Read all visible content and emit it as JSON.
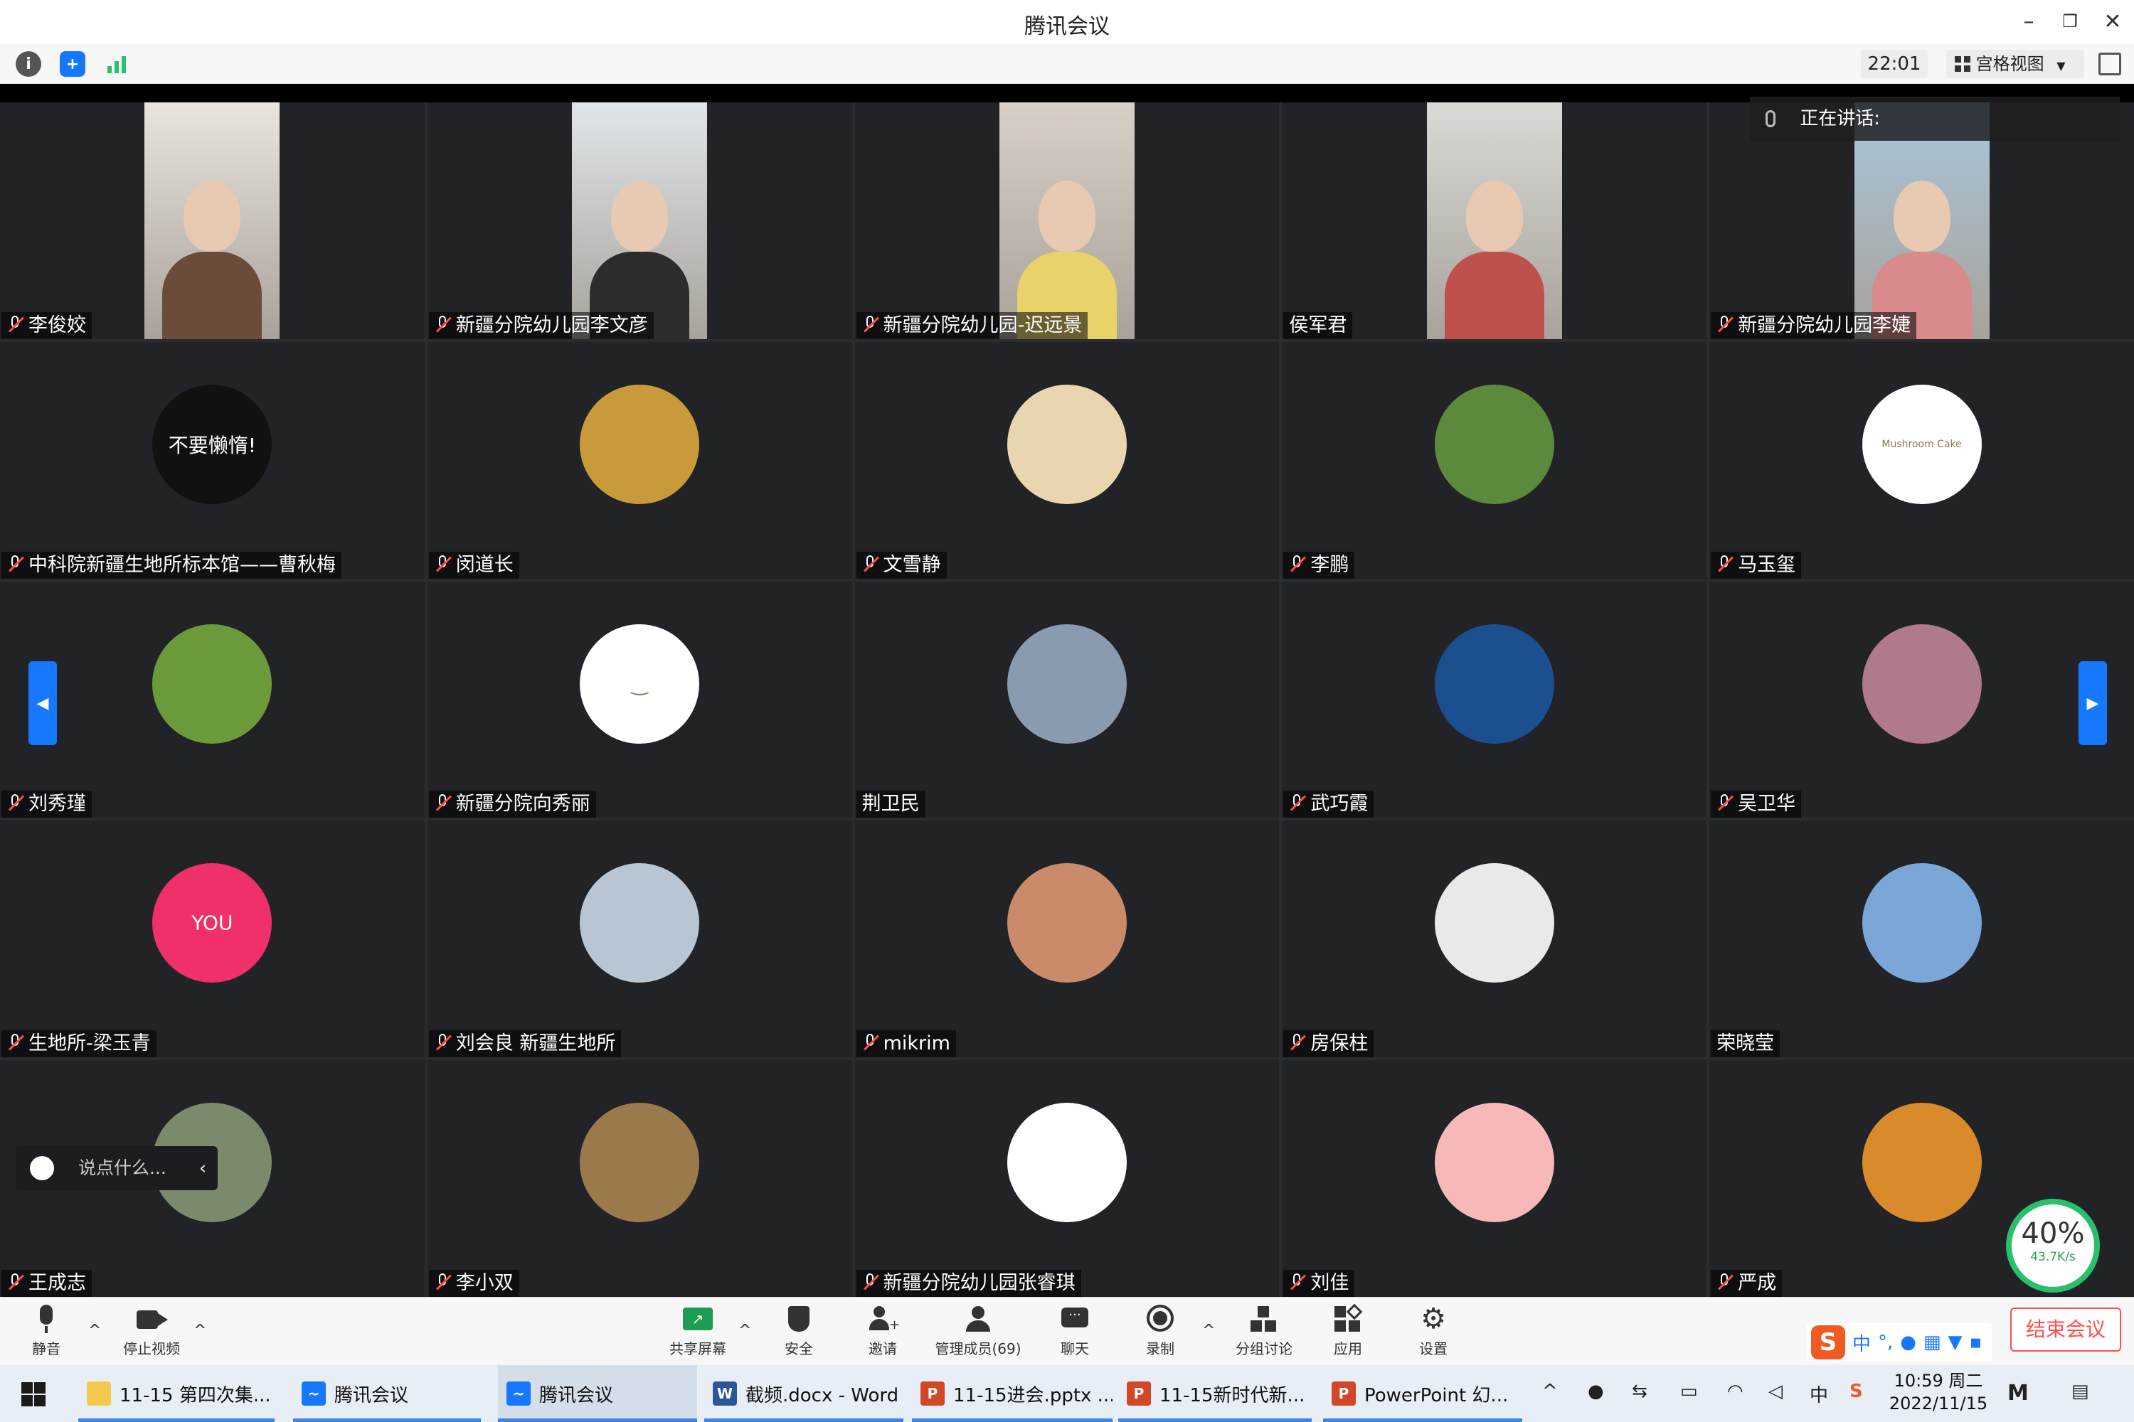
{
  "window": {
    "title": "腾讯会议"
  },
  "toolbar": {
    "time": "22:01",
    "view_label": "宫格视图"
  },
  "speaking": {
    "label": "正在讲话:"
  },
  "participants": [
    {
      "name": "李俊姣",
      "type": "video",
      "muted": true,
      "bg": "#e9e4de",
      "shirt": "#6b4b3a"
    },
    {
      "name": "新疆分院幼儿园李文彦",
      "type": "video",
      "muted": true,
      "bg": "#dfe6ea",
      "shirt": "#2c2c2c"
    },
    {
      "name": "新疆分院幼儿园-迟远景",
      "type": "video",
      "muted": true,
      "bg": "#d8d0c6",
      "shirt": "#e8d36a"
    },
    {
      "name": "侯军君",
      "type": "video",
      "muted": false,
      "bg": "#d9dad6",
      "shirt": "#c0504d"
    },
    {
      "name": "新疆分院幼儿园李婕",
      "type": "video",
      "muted": true,
      "bg": "#a9c6dc",
      "shirt": "#d98a8a"
    },
    {
      "name": "中科院新疆生地所标本馆——曹秋梅",
      "type": "avatar",
      "muted": true,
      "avatar_color": "#111111",
      "avatar_text": "不要懒惰!"
    },
    {
      "name": "闵道长",
      "type": "avatar",
      "muted": true,
      "avatar_color": "#c99a3a",
      "avatar_text": ""
    },
    {
      "name": "文雪静",
      "type": "avatar",
      "muted": true,
      "avatar_color": "#e9d6b0",
      "avatar_text": ""
    },
    {
      "name": "李鹏",
      "type": "avatar",
      "muted": true,
      "avatar_color": "#5b8a3c",
      "avatar_text": ""
    },
    {
      "name": "马玉玺",
      "type": "avatar",
      "muted": true,
      "avatar_color": "#ffffff",
      "avatar_text": "Mushroom Cake"
    },
    {
      "name": "刘秀瑾",
      "type": "avatar",
      "muted": true,
      "avatar_color": "#6a9a3a",
      "avatar_text": ""
    },
    {
      "name": "新疆分院向秀丽",
      "type": "avatar",
      "muted": true,
      "avatar_color": "#ffffff",
      "avatar_text": "‿"
    },
    {
      "name": "荆卫民",
      "type": "avatar",
      "muted": false,
      "avatar_color": "#8a9bb0",
      "avatar_text": ""
    },
    {
      "name": "武巧霞",
      "type": "avatar",
      "muted": true,
      "avatar_color": "#1c4f8f",
      "avatar_text": ""
    },
    {
      "name": "吴卫华",
      "type": "avatar",
      "muted": true,
      "avatar_color": "#b07a8e",
      "avatar_text": ""
    },
    {
      "name": "生地所-梁玉青",
      "type": "avatar",
      "muted": true,
      "avatar_color": "#f0306a",
      "avatar_text": "YOU"
    },
    {
      "name": "刘会良 新疆生地所",
      "type": "avatar",
      "muted": true,
      "avatar_color": "#b8c6d4",
      "avatar_text": ""
    },
    {
      "name": "mikrim",
      "type": "avatar",
      "muted": true,
      "avatar_color": "#c98b6a",
      "avatar_text": ""
    },
    {
      "name": "房保柱",
      "type": "avatar",
      "muted": true,
      "avatar_color": "#e9e9ea",
      "avatar_text": ""
    },
    {
      "name": "荣晓莹",
      "type": "avatar",
      "muted": false,
      "avatar_color": "#7aa7d8",
      "avatar_text": ""
    },
    {
      "name": "王成志",
      "type": "avatar",
      "muted": true,
      "avatar_color": "#7a8a6a",
      "avatar_text": ""
    },
    {
      "name": "李小双",
      "type": "avatar",
      "muted": true,
      "avatar_color": "#9a7a4a",
      "avatar_text": ""
    },
    {
      "name": "新疆分院幼儿园张睿琪",
      "type": "avatar",
      "muted": true,
      "avatar_color": "#ffffff",
      "avatar_text": ""
    },
    {
      "name": "刘佳",
      "type": "avatar",
      "muted": true,
      "avatar_color": "#f7b8b8",
      "avatar_text": ""
    },
    {
      "name": "严成",
      "type": "avatar",
      "muted": true,
      "avatar_color": "#d98a2a",
      "avatar_text": ""
    }
  ],
  "chat": {
    "placeholder": "说点什么..."
  },
  "network": {
    "percent": "40%",
    "speed": "43.7K/s"
  },
  "bottombar": {
    "mute": "静音",
    "stop_video": "停止视频",
    "share": "共享屏幕",
    "security": "安全",
    "invite": "邀请",
    "members": "管理成员(69)",
    "chat": "聊天",
    "record": "录制",
    "breakout": "分组讨论",
    "apps": "应用",
    "settings": "设置",
    "leave": "结束会议"
  },
  "ime": {
    "lang": "中"
  },
  "taskbar": {
    "items": [
      {
        "label": "11-15 第四次集...",
        "color": "#f2c94c",
        "glyph": ""
      },
      {
        "label": "腾讯会议",
        "color": "#1677ff",
        "glyph": "~"
      },
      {
        "label": "腾讯会议",
        "color": "#1677ff",
        "glyph": "~"
      },
      {
        "label": "截频.docx - Word",
        "color": "#2b579a",
        "glyph": "W"
      },
      {
        "label": "11-15进会.pptx ...",
        "color": "#d24726",
        "glyph": "P"
      },
      {
        "label": "11-15新时代新...",
        "color": "#d24726",
        "glyph": "P"
      },
      {
        "label": "PowerPoint 幻...",
        "color": "#d24726",
        "glyph": "P"
      }
    ],
    "clock_time": "10:59 周二",
    "clock_date": "2022/11/15",
    "tray_ime": "中"
  }
}
